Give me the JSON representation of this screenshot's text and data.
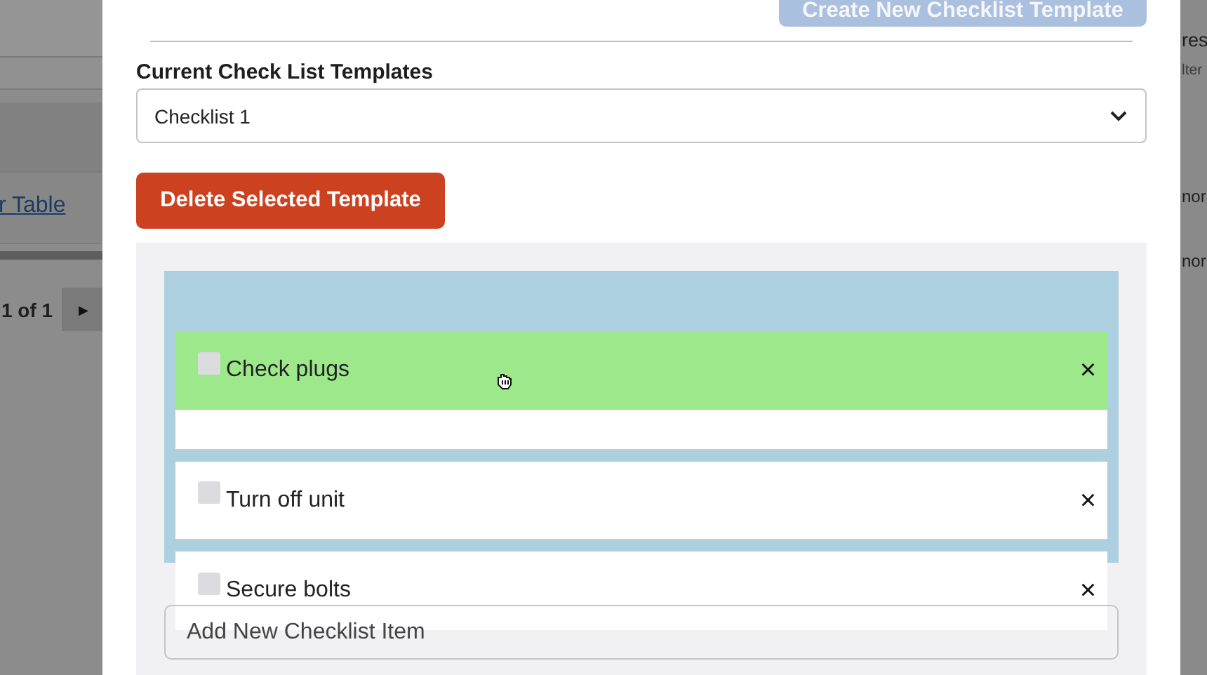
{
  "background": {
    "link": "r Table",
    "pager": "1 of 1",
    "next_icon": "▶",
    "right_texts": [
      {
        "text": "res",
        "kind": "heading"
      },
      {
        "text": "lter",
        "kind": "hint"
      },
      {
        "text": "nor",
        "kind": "cell"
      },
      {
        "text": "nor",
        "kind": "cell"
      }
    ]
  },
  "modal": {
    "create_button": {
      "label": "Create New Checklist Template",
      "disabled": true
    },
    "templates_label": "Current Check List Templates",
    "template_select": {
      "value": "Checklist 1"
    },
    "delete_button": "Delete Selected Template",
    "items": [
      {
        "kind": "covered"
      },
      {
        "label": "Turn off unit",
        "checked": false,
        "remove": "×"
      },
      {
        "label": "Secure bolts",
        "checked": false,
        "remove": "×"
      }
    ],
    "dragged_item": {
      "label": "Check plugs",
      "checked": false,
      "remove": "×"
    },
    "new_item": {
      "placeholder": "Add New Checklist Item"
    }
  }
}
